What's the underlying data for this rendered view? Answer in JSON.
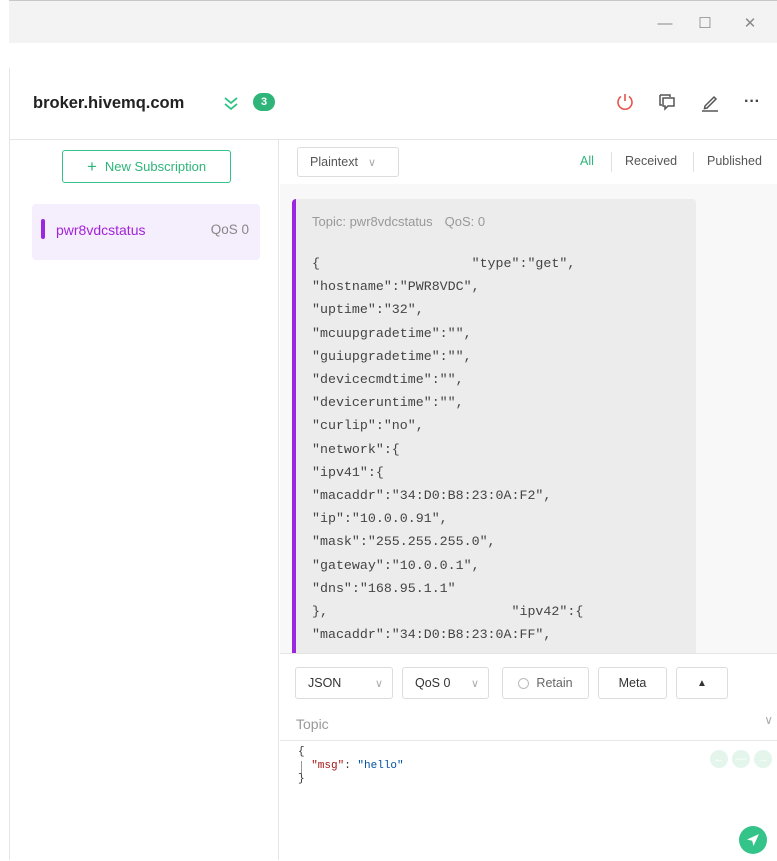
{
  "window": {
    "minimize_glyph": "—",
    "maximize_glyph": "☐",
    "close_glyph": "✕"
  },
  "header": {
    "broker": "broker.hivemq.com",
    "connection_count": "3",
    "icons": [
      "power-icon",
      "copy-icon",
      "edit-icon",
      "more-icon"
    ],
    "more_glyph": "···"
  },
  "sidebar": {
    "new_subscription_label": "New Subscription",
    "subscriptions": [
      {
        "topic": "pwr8vdcstatus",
        "qos": "QoS 0",
        "color": "#9b28e0"
      }
    ]
  },
  "toolbar": {
    "format": "Plaintext",
    "filters": [
      "All",
      "Received",
      "Published"
    ],
    "active_filter": "All"
  },
  "message": {
    "topic_label": "Topic: pwr8vdcstatus",
    "qos_label": "QoS: 0",
    "body": "{                   \"type\":\"get\",\n\"hostname\":\"PWR8VDC\",\n\"uptime\":\"32\",\n\"mcuupgradetime\":\"\",\n\"guiupgradetime\":\"\",\n\"devicecmdtime\":\"\",\n\"deviceruntime\":\"\",\n\"curlip\":\"no\",\n\"network\":{\n\"ipv41\":{\n\"macaddr\":\"34:D0:B8:23:0A:F2\",\n\"ip\":\"10.0.0.91\",\n\"mask\":\"255.255.255.0\",\n\"gateway\":\"10.0.0.1\",\n\"dns\":\"168.95.1.1\"\n},                       \"ipv42\":{\n\"macaddr\":\"34:D0:B8:23:0A:FF\","
  },
  "composer": {
    "payload_format": "JSON",
    "qos": "QoS 0",
    "retain_label": "Retain",
    "meta_label": "Meta",
    "topic_placeholder": "Topic",
    "payload": {
      "open": "{",
      "key": "\"msg\"",
      "colon": ": ",
      "value": "\"hello\"",
      "close": "}"
    }
  },
  "colors": {
    "accent": "#34c388",
    "subscription": "#9b28e0",
    "badge": "#2fb57a",
    "power": "#e5534b"
  }
}
